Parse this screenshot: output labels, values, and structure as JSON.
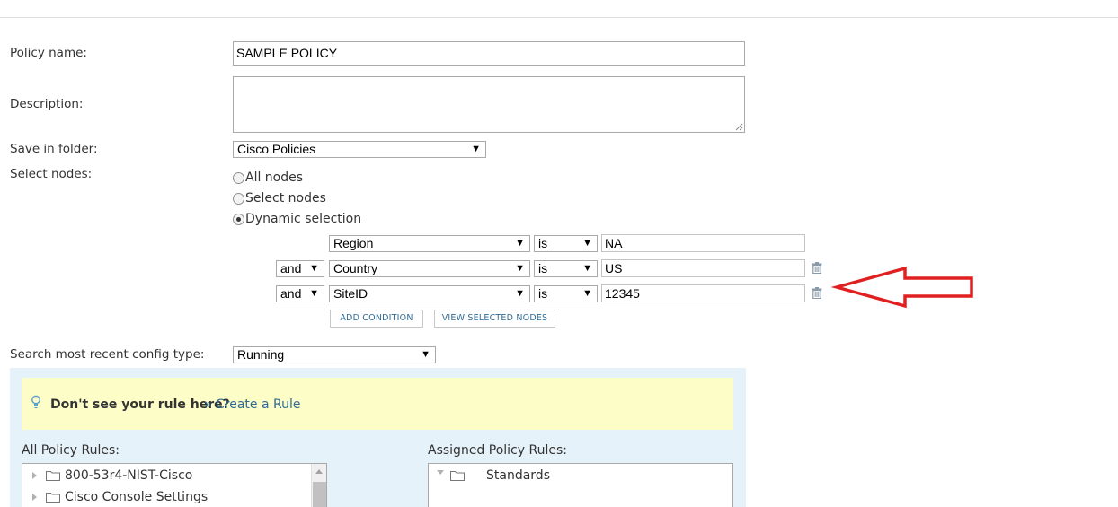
{
  "form": {
    "policy_name_label": "Policy name:",
    "policy_name_value": "SAMPLE POLICY",
    "description_label": "Description:",
    "description_value": "",
    "folder_label": "Save in folder:",
    "folder_value": "Cisco Policies",
    "select_nodes_label": "Select nodes:",
    "radio_all": "All nodes",
    "radio_select": "Select nodes",
    "radio_dynamic": "Dynamic selection",
    "selected_radio": "Dynamic selection",
    "config_type_label": "Search most recent config type:",
    "config_type_value": "Running"
  },
  "conditions": [
    {
      "connector": "",
      "field": "Region",
      "operator": "is",
      "value": "NA",
      "deletable": false
    },
    {
      "connector": "and",
      "field": "Country",
      "operator": "is",
      "value": "US",
      "deletable": true
    },
    {
      "connector": "and",
      "field": "SiteID",
      "operator": "is",
      "value": "12345",
      "deletable": true
    }
  ],
  "buttons": {
    "add_condition": "ADD CONDITION",
    "view_selected": "VIEW SELECTED NODES"
  },
  "hint": {
    "bold": "Don't see your rule here?",
    "link": "» Create a Rule"
  },
  "rules": {
    "all_label": "All Policy Rules:",
    "all_items": [
      "800-53r4-NIST-Cisco",
      "Cisco Console Settings"
    ],
    "assigned_label": "Assigned Policy Rules:",
    "assigned_items": [
      "Standards"
    ]
  },
  "colors": {
    "arrow": "#e02020",
    "panel_bg": "#e6f2f9",
    "hint_bg": "#fdfdc8",
    "link": "#2e6b94"
  }
}
